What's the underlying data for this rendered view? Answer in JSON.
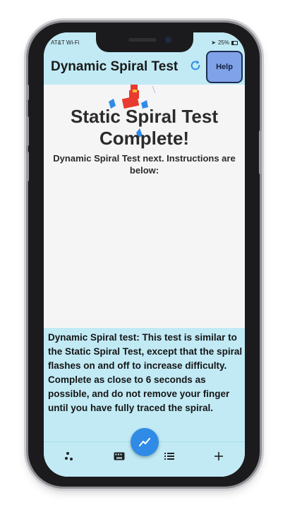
{
  "status_bar": {
    "carrier": "AT&T Wi-Fi",
    "battery": "25%"
  },
  "header": {
    "title": "Dynamic Spiral Test",
    "help_label": "Help"
  },
  "main": {
    "title": "Static Spiral Test Complete!",
    "subtitle": "Dynamic Spiral Test next. Instructions are below:"
  },
  "instructions": {
    "text": "Dynamic Spiral test: This test is similar to the Static Spiral Test, except that the spiral flashes on and off to increase difficulty. Complete as close to 6 seconds as possible, and do not remove your finger until you have fully traced the spiral."
  },
  "bottom_nav": {
    "items": [
      {
        "icon": "dots-icon"
      },
      {
        "icon": "keyboard-icon"
      },
      {
        "icon": "trend-icon"
      },
      {
        "icon": "list-icon"
      },
      {
        "icon": "plus-icon"
      }
    ]
  },
  "colors": {
    "header_bg": "#c1eaf5",
    "help_button": "#7fa2e8",
    "fab": "#2f8be6",
    "accent_red": "#e83a2f",
    "accent_blue": "#2f8be6"
  }
}
